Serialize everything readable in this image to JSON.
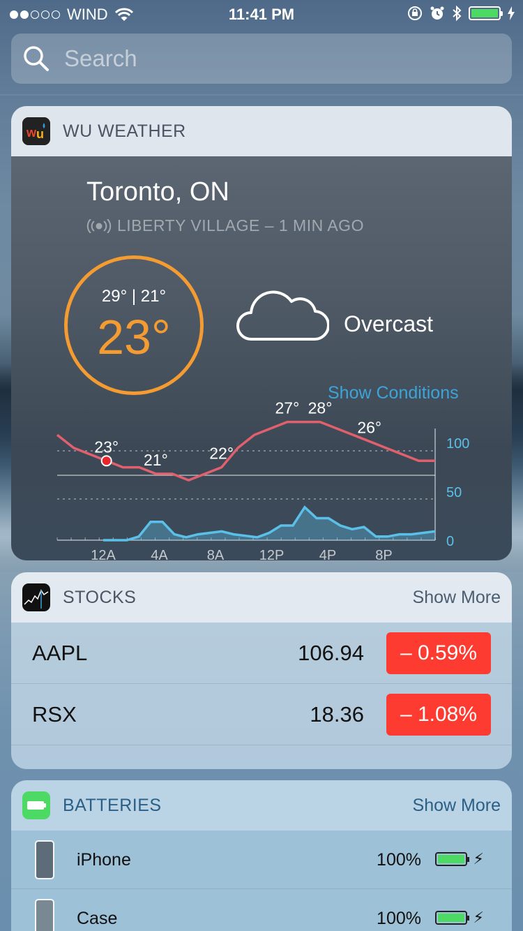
{
  "status_bar": {
    "carrier": "WIND",
    "time": "11:41 PM",
    "signal_bars_filled": 2,
    "signal_bars_total": 5,
    "battery_level": 1.0
  },
  "search": {
    "placeholder": "Search"
  },
  "weather_widget": {
    "title": "WU WEATHER",
    "city": "Toronto, ON",
    "station": "LIBERTY VILLAGE – 1 MIN AGO",
    "hi_lo": "29° | 21°",
    "current_temp": "23°",
    "condition": "Overcast",
    "show_conditions": "Show Conditions",
    "accent_color": "#f49b32",
    "link_color": "#3ca4d8"
  },
  "chart_data": {
    "type": "line",
    "x_tick_labels": [
      "12A",
      "4A",
      "8A",
      "12P",
      "4P",
      "8P"
    ],
    "y_right_ticks": [
      "100",
      "50",
      "0"
    ],
    "series": [
      {
        "color": "#e0606e",
        "values": [
          27,
          25,
          24,
          23,
          22,
          22,
          21,
          21,
          20,
          21,
          22,
          25,
          27,
          28,
          29,
          29,
          29,
          28,
          27,
          26,
          25,
          24,
          23,
          23
        ],
        "data_labels": [
          {
            "index": 3,
            "text": "23°"
          },
          {
            "index": 6,
            "text": "21°"
          },
          {
            "index": 10,
            "text": "22°"
          },
          {
            "index": 14,
            "text": "27°"
          },
          {
            "index": 16,
            "text": "28°"
          },
          {
            "index": 19,
            "text": "26°"
          }
        ]
      },
      {
        "color": "#5bc0e8",
        "values": [
          0,
          0,
          0,
          5,
          25,
          25,
          8,
          4,
          8,
          10,
          12,
          8,
          6,
          4,
          10,
          20,
          20,
          45,
          30,
          30,
          20,
          15,
          18,
          5,
          5,
          8,
          8,
          10,
          12
        ],
        "axis": "right"
      }
    ],
    "y_right_lim": [
      0,
      100
    ]
  },
  "stocks_widget": {
    "title": "STOCKS",
    "show_more": "Show More",
    "rows": [
      {
        "symbol": "AAPL",
        "price": "106.94",
        "change": "– 0.59%"
      },
      {
        "symbol": "RSX",
        "price": "18.36",
        "change": "– 1.08%"
      }
    ],
    "negative_color": "#fd3b30"
  },
  "batteries_widget": {
    "title": "BATTERIES",
    "show_more": "Show More",
    "rows": [
      {
        "name": "iPhone",
        "percent": "100%",
        "level": 1.0
      },
      {
        "name": "Case",
        "percent": "100%",
        "level": 1.0
      }
    ]
  }
}
